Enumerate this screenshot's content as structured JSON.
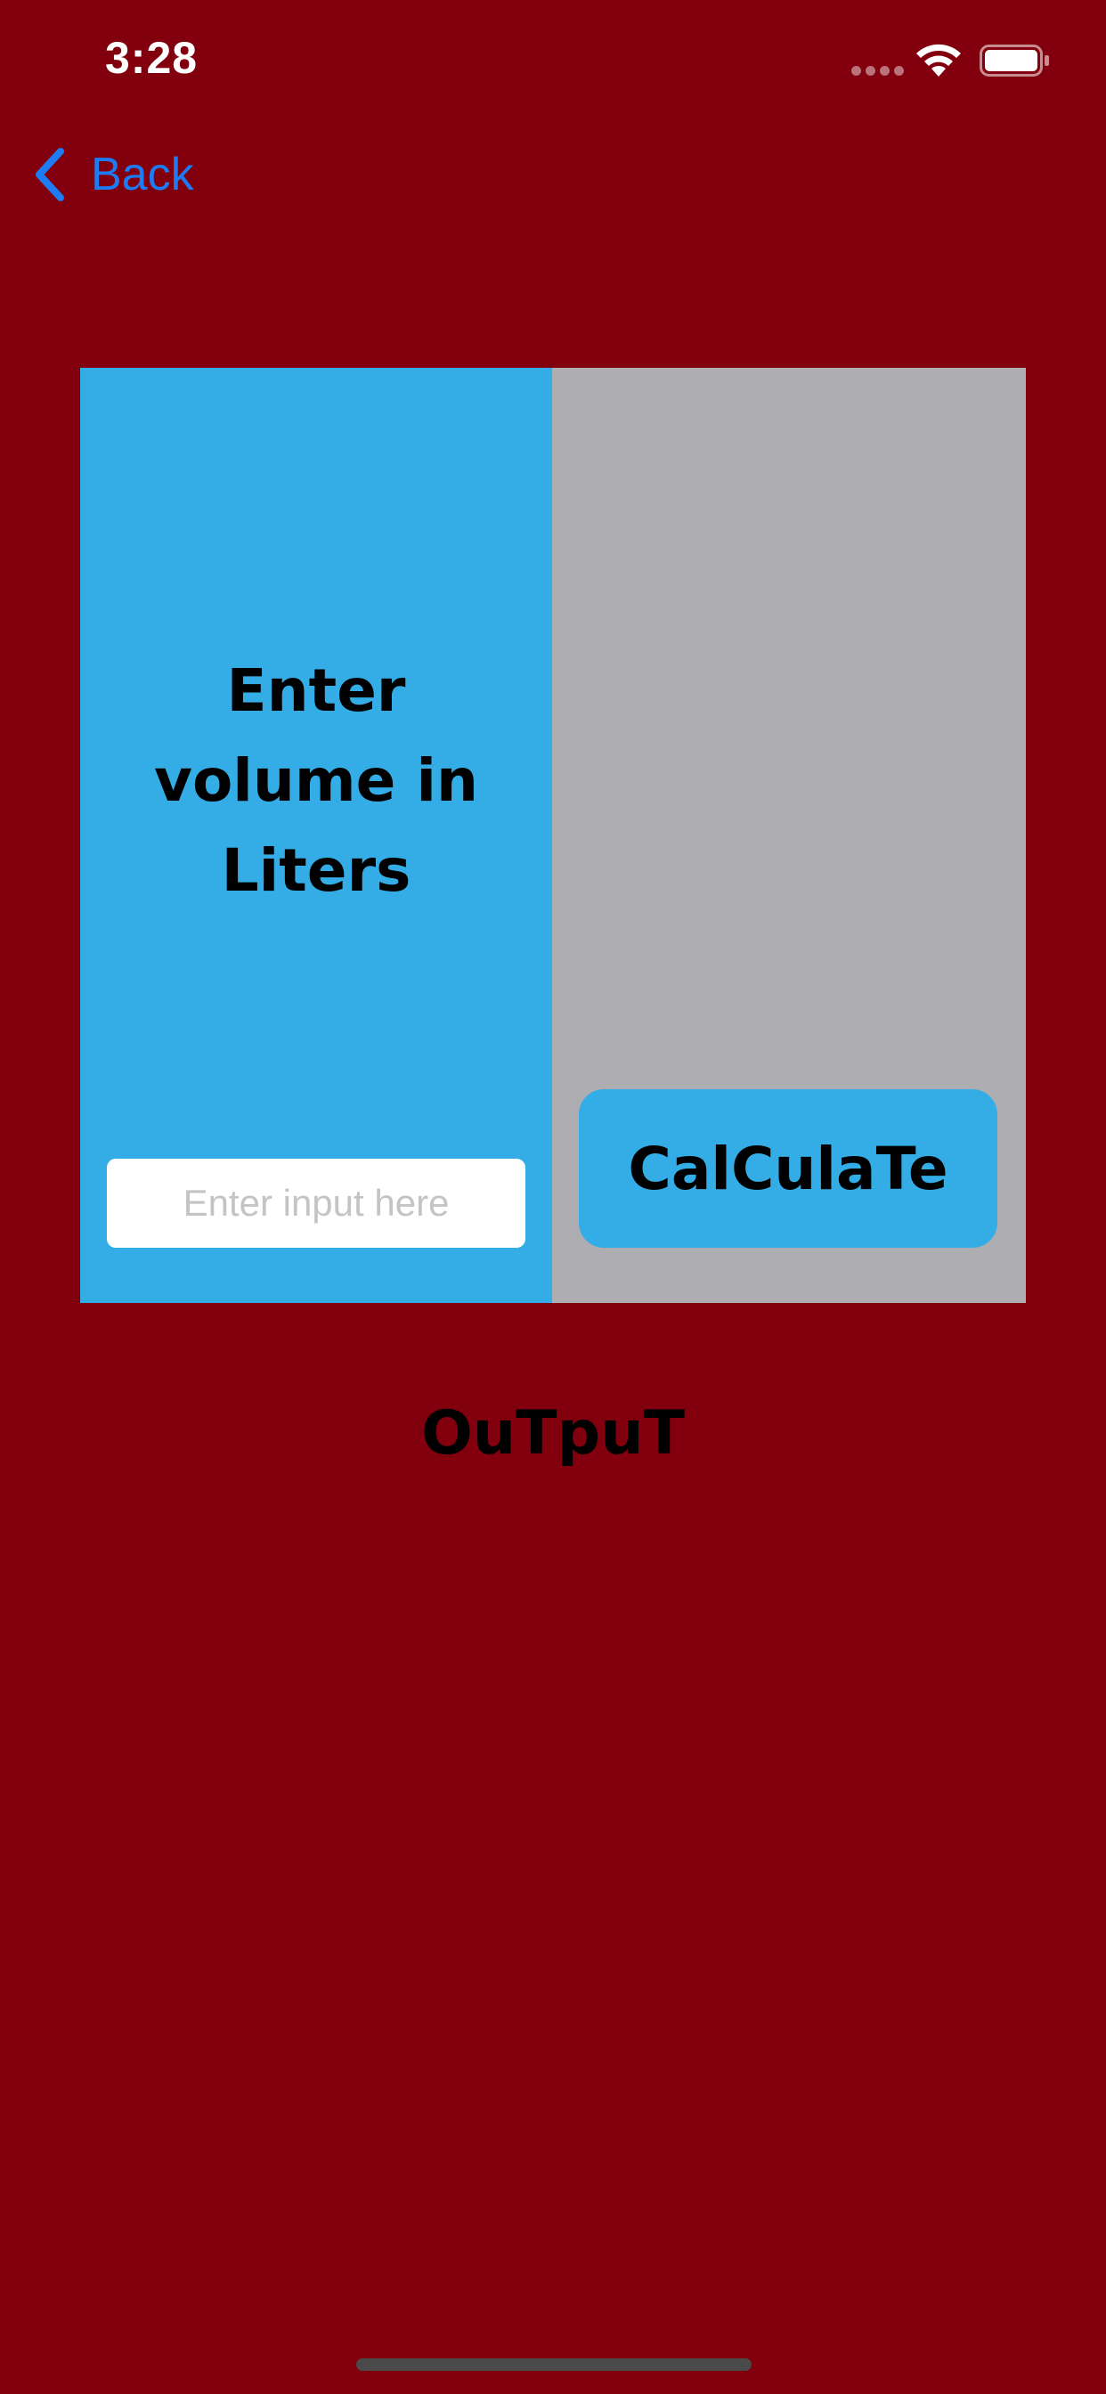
{
  "status_bar": {
    "time": "3:28"
  },
  "nav": {
    "back_label": "Back",
    "back_icon": "chevron-left-icon"
  },
  "converter": {
    "prompt": "Enter volume in Liters",
    "input_value": "",
    "input_placeholder": "Enter input here",
    "calculate_label": "CalCulaTe"
  },
  "result": {
    "output_label": "OuTpuT"
  },
  "colors": {
    "background": "#82000E",
    "panel_left": "#34ADE6",
    "panel_right": "#AEADB1",
    "button": "#34ADE6",
    "link": "#1D7CF2"
  }
}
